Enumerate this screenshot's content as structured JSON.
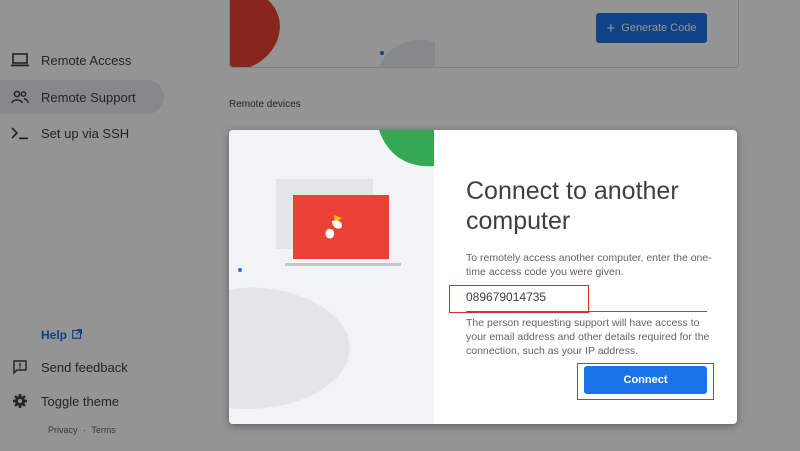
{
  "sidebar": {
    "items": [
      {
        "label": "Remote Access",
        "icon": "laptop-icon"
      },
      {
        "label": "Remote Support",
        "icon": "people-icon",
        "active": true
      },
      {
        "label": "Set up via SSH",
        "icon": "terminal-icon"
      }
    ],
    "help_label": "Help",
    "send_feedback_label": "Send feedback",
    "toggle_theme_label": "Toggle theme",
    "footer": {
      "privacy": "Privacy",
      "separator": "·",
      "terms": "Terms"
    }
  },
  "top_card": {
    "generate_code_label": "Generate Code"
  },
  "remote_devices_label": "Remote devices",
  "dialog": {
    "title": "Connect to another computer",
    "description": "To remotely access another computer, enter the one-time access code you were given.",
    "code_value": "089679014735",
    "note": "The person requesting support will have access to your email address and other details required for the connection, such as your IP address.",
    "connect_label": "Connect"
  },
  "colors": {
    "accent": "#1a73e8",
    "highlight": "#d93025",
    "illustration_red": "#ea4335",
    "illustration_green": "#34a853"
  }
}
